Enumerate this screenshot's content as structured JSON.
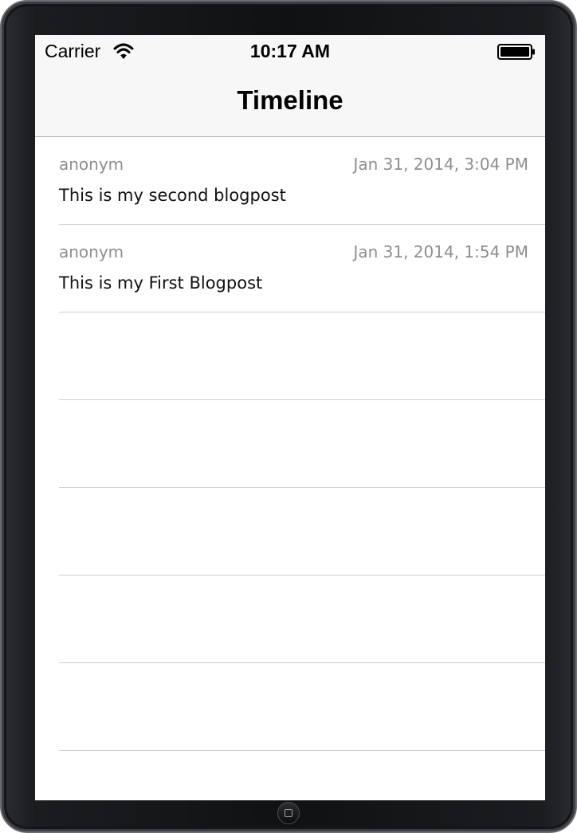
{
  "status_bar": {
    "carrier": "Carrier",
    "time": "10:17 AM",
    "wifi_icon": "wifi-icon",
    "battery_icon": "battery-icon"
  },
  "nav_bar": {
    "title": "Timeline"
  },
  "posts": [
    {
      "author": "anonym",
      "date": "Jan 31, 2014, 3:04 PM",
      "text": "This is my second blogpost"
    },
    {
      "author": "anonym",
      "date": "Jan 31, 2014, 1:54 PM",
      "text": "This is my First Blogpost"
    }
  ],
  "colors": {
    "nav_background": "#f7f7f7",
    "secondary_text": "#8e8e8e",
    "separator": "#d0d0d4"
  }
}
